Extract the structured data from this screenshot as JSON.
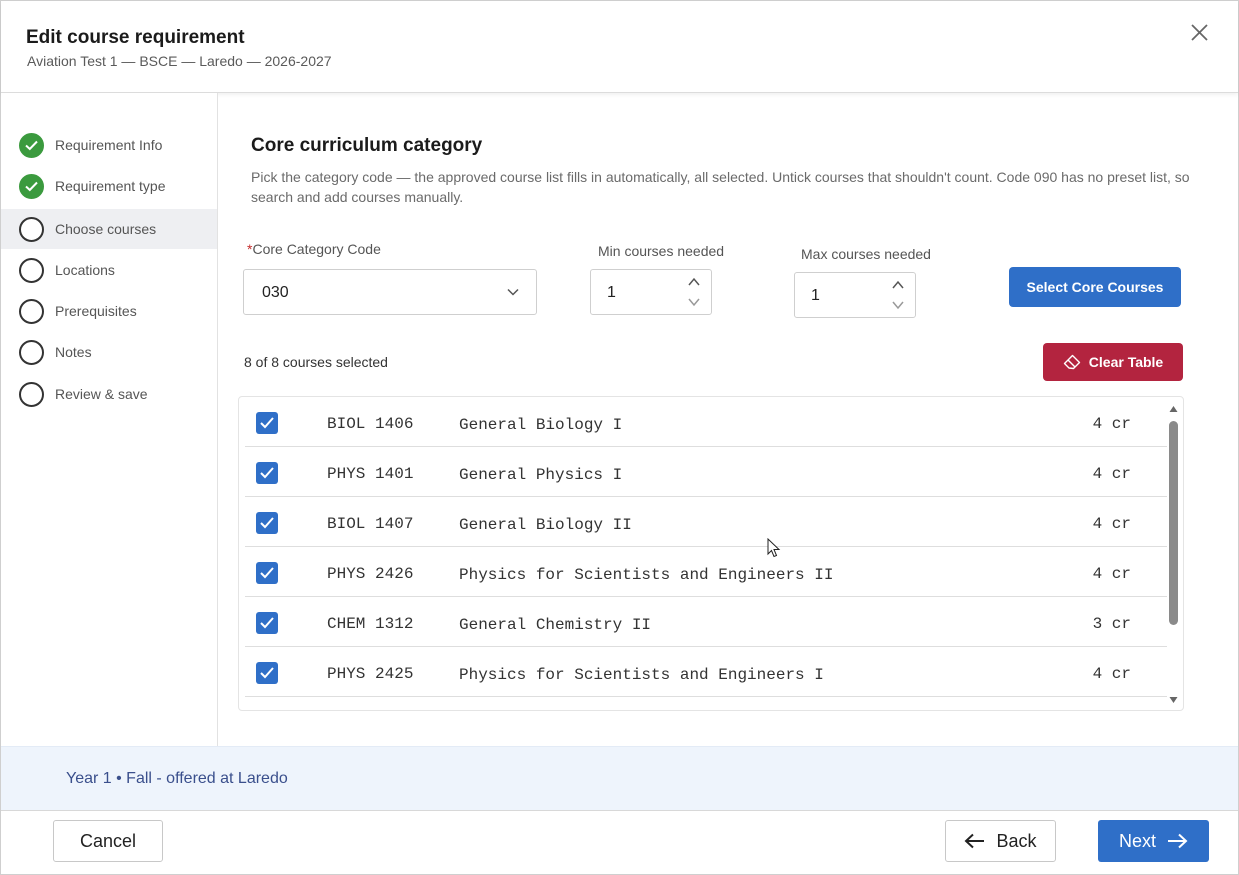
{
  "header": {
    "title": "Edit course requirement",
    "subtitle": "Aviation Test 1 — BSCE — Laredo — 2026-2027",
    "close_icon": "close-icon"
  },
  "sidebar": {
    "steps": [
      {
        "label": "Requirement Info",
        "state": "done"
      },
      {
        "label": "Requirement type",
        "state": "done"
      },
      {
        "label": "Choose courses",
        "state": "active"
      },
      {
        "label": "Locations",
        "state": "pending"
      },
      {
        "label": "Prerequisites",
        "state": "pending"
      },
      {
        "label": "Notes",
        "state": "pending"
      },
      {
        "label": "Review & save",
        "state": "pending"
      }
    ]
  },
  "main": {
    "section_title": "Core curriculum category",
    "section_desc": "Pick the category code — the approved course list fills in automatically, all selected. Untick courses that shouldn't count. Code 090 has no preset list, so search and add courses manually.",
    "category": {
      "label": "Core Category Code",
      "required_mark": "*",
      "value": "030"
    },
    "min_courses": {
      "label": "Min courses needed",
      "value": "1"
    },
    "max_courses": {
      "label": "Max courses needed",
      "value": "1"
    },
    "select_button": "Select Core Courses",
    "selected_count": "8 of 8 courses selected",
    "clear_button": "Clear Table",
    "courses": [
      {
        "code": "BIOL 1406",
        "name": "General Biology I",
        "credits": "4 cr",
        "checked": true
      },
      {
        "code": "PHYS 1401",
        "name": "General Physics I",
        "credits": "4 cr",
        "checked": true
      },
      {
        "code": "BIOL 1407",
        "name": "General Biology II",
        "credits": "4 cr",
        "checked": true
      },
      {
        "code": "PHYS 2426",
        "name": "Physics for Scientists and Engineers II",
        "credits": "4 cr",
        "checked": true
      },
      {
        "code": "CHEM 1312",
        "name": "General Chemistry II",
        "credits": "3 cr",
        "checked": true
      },
      {
        "code": "PHYS 2425",
        "name": "Physics for Scientists and Engineers I",
        "credits": "4 cr",
        "checked": true
      }
    ]
  },
  "info_bar": {
    "text": "Year 1 • Fall - offered at Laredo"
  },
  "footer": {
    "cancel": "Cancel",
    "back": "Back",
    "next": "Next"
  },
  "colors": {
    "primary": "#2f6fc8",
    "danger": "#b3243f",
    "done": "#3b9a3e",
    "info_bg": "#eef4fc"
  }
}
